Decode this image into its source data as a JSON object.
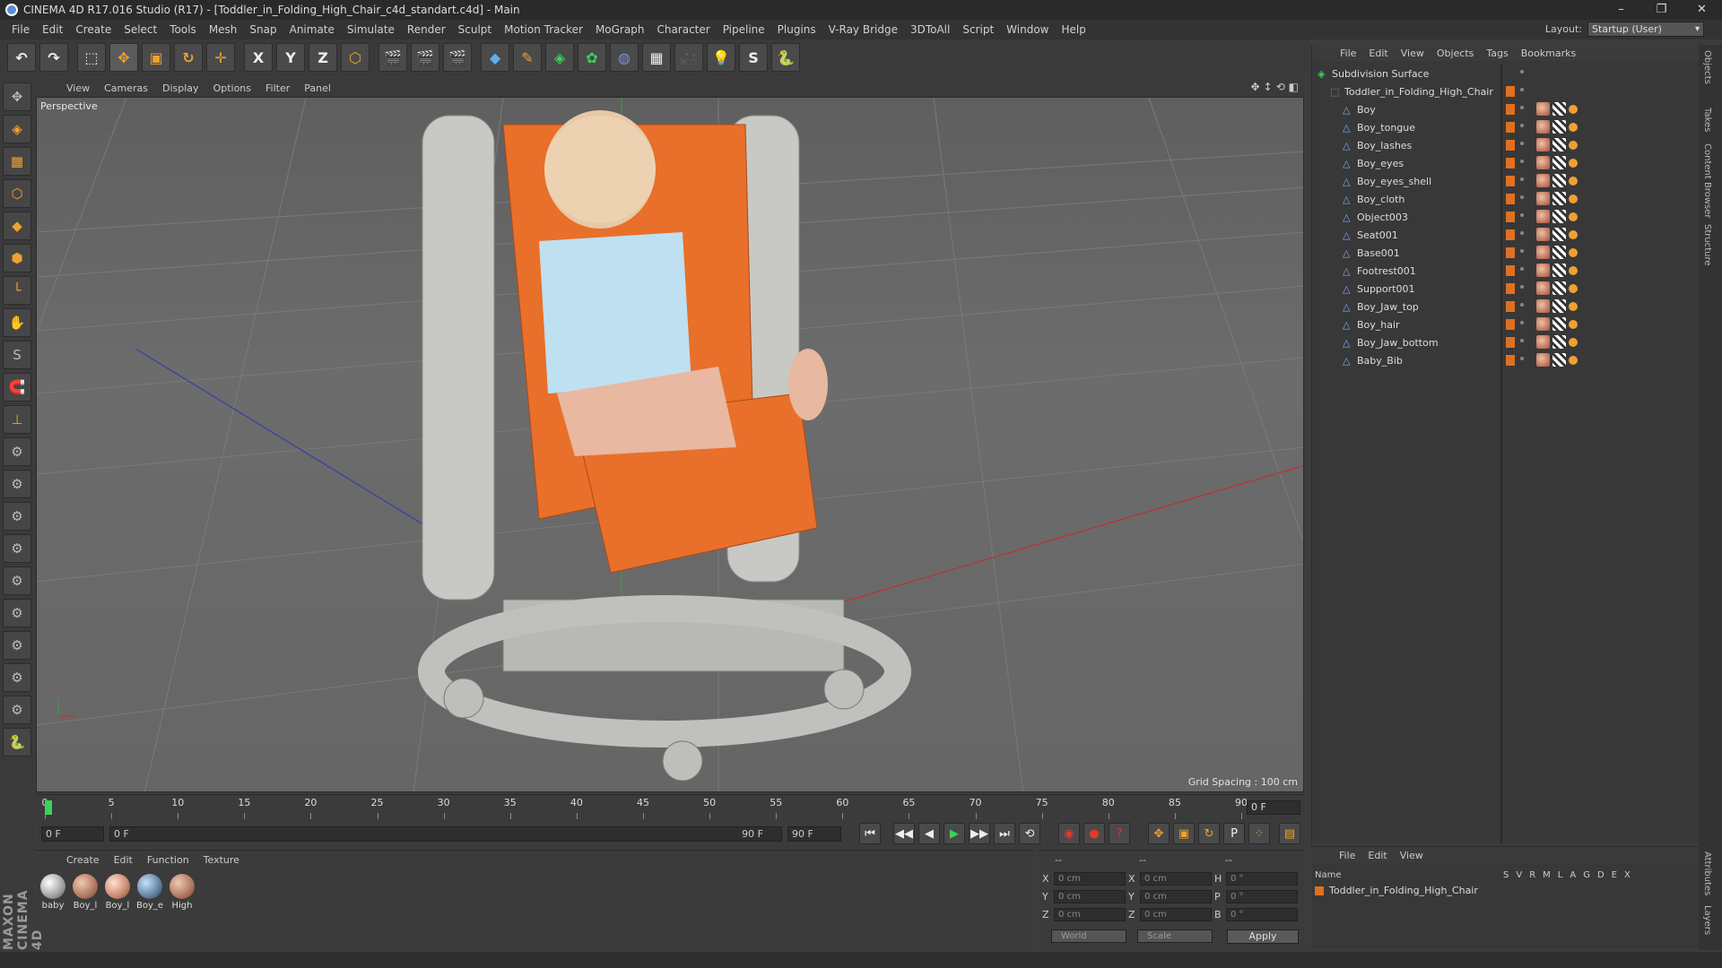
{
  "window": {
    "title": "CINEMA 4D R17.016 Studio (R17) - [Toddler_in_Folding_High_Chair_c4d_standart.c4d] - Main",
    "minimize": "–",
    "maximize": "❐",
    "close": "✕"
  },
  "menubar": {
    "items": [
      "File",
      "Edit",
      "Create",
      "Select",
      "Tools",
      "Mesh",
      "Snap",
      "Animate",
      "Simulate",
      "Render",
      "Sculpt",
      "Motion Tracker",
      "MoGraph",
      "Character",
      "Pipeline",
      "Plugins",
      "V-Ray Bridge",
      "3DToAll",
      "Script",
      "Window",
      "Help"
    ],
    "layout_label": "Layout:",
    "layout_value": "Startup (User)"
  },
  "toolbar": {
    "buttons": [
      "↶",
      "↷",
      "⬚",
      "✥",
      "▣",
      "↻",
      "✛",
      "X",
      "Y",
      "Z",
      "⬡",
      "🎬",
      "🎬",
      "🎬",
      "◆",
      "✎",
      "◈",
      "✿",
      "◍",
      "▦",
      "🎥",
      "💡",
      "S",
      "🐍"
    ]
  },
  "lefttools": [
    "✥",
    "◈",
    "▦",
    "⬡",
    "◆",
    "⬢",
    "└",
    "✋",
    "S",
    "🧲",
    "⊥",
    "⚙",
    "⚙",
    "⚙",
    "⚙",
    "⚙",
    "⚙",
    "⚙",
    "⚙",
    "⚙",
    "🐍"
  ],
  "viewport": {
    "menu": [
      "View",
      "Cameras",
      "Display",
      "Options",
      "Filter",
      "Panel"
    ],
    "label": "Perspective",
    "grid_spacing": "Grid Spacing : 100 cm",
    "nav_icons": [
      "✥",
      "↕",
      "⟲",
      "◧"
    ]
  },
  "timeline": {
    "ticks": [
      "0",
      "5",
      "10",
      "15",
      "20",
      "25",
      "30",
      "35",
      "40",
      "45",
      "50",
      "55",
      "60",
      "65",
      "70",
      "75",
      "80",
      "85",
      "90"
    ],
    "frame_display": "0 F"
  },
  "transport": {
    "start_field": "0 F",
    "range_left": "0 F",
    "range_right": "90 F",
    "end_field": "90 F",
    "buttons": [
      "⏮",
      "◀◀",
      "◀",
      "▶",
      "▶▶",
      "⏭",
      "⟲"
    ],
    "record_buttons": [
      "◉",
      "●",
      "?"
    ],
    "key_buttons": [
      "✥",
      "▣",
      "↻",
      "P",
      "⁘",
      "▤"
    ]
  },
  "material_manager": {
    "menu": [
      "Create",
      "Edit",
      "Function",
      "Texture"
    ],
    "materials": [
      "baby",
      "Boy_l",
      "Boy_l",
      "Boy_e",
      "High"
    ]
  },
  "coordinates": {
    "rows": [
      {
        "a1": "X",
        "v1": "0 cm",
        "a2": "X",
        "v2": "0 cm",
        "a3": "H",
        "v3": "0 °"
      },
      {
        "a1": "Y",
        "v1": "0 cm",
        "a2": "Y",
        "v2": "0 cm",
        "a3": "P",
        "v3": "0 °"
      },
      {
        "a1": "Z",
        "v1": "0 cm",
        "a2": "Z",
        "v2": "0 cm",
        "a3": "B",
        "v3": "0 °"
      }
    ],
    "mode1": "World",
    "mode2": "Scale",
    "apply": "Apply",
    "header_left": "--",
    "header_mid": "--",
    "header_right": "--"
  },
  "object_manager": {
    "menu": [
      "File",
      "Edit",
      "View",
      "Objects",
      "Tags",
      "Bookmarks"
    ],
    "objects": [
      {
        "name": "Subdivision Surface",
        "level": 0
      },
      {
        "name": "Toddler_in_Folding_High_Chair",
        "level": 1
      },
      {
        "name": "Boy",
        "level": 2
      },
      {
        "name": "Boy_tongue",
        "level": 2
      },
      {
        "name": "Boy_lashes",
        "level": 2
      },
      {
        "name": "Boy_eyes",
        "level": 2
      },
      {
        "name": "Boy_eyes_shell",
        "level": 2
      },
      {
        "name": "Boy_cloth",
        "level": 2
      },
      {
        "name": "Object003",
        "level": 2
      },
      {
        "name": "Seat001",
        "level": 2
      },
      {
        "name": "Base001",
        "level": 2
      },
      {
        "name": "Footrest001",
        "level": 2
      },
      {
        "name": "Support001",
        "level": 2
      },
      {
        "name": "Boy_Jaw_top",
        "level": 2
      },
      {
        "name": "Boy_hair",
        "level": 2
      },
      {
        "name": "Boy_Jaw_bottom",
        "level": 2
      },
      {
        "name": "Baby_Bib",
        "level": 2
      }
    ]
  },
  "layers": {
    "menu": [
      "File",
      "Edit",
      "View"
    ],
    "name_header": "Name",
    "columns": [
      "S",
      "V",
      "R",
      "M",
      "L",
      "A",
      "G",
      "D",
      "E",
      "X"
    ],
    "row": "Toddler_in_Folding_High_Chair"
  },
  "side_tabs": [
    "Objects",
    "Takes",
    "Content Browser",
    "Structure",
    "Attributes",
    "Layers"
  ],
  "branding": "MAXON CINEMA 4D",
  "colors": {
    "accent_orange": "#e07020",
    "play_green": "#3ad35a",
    "record_red": "#e03a2a"
  }
}
